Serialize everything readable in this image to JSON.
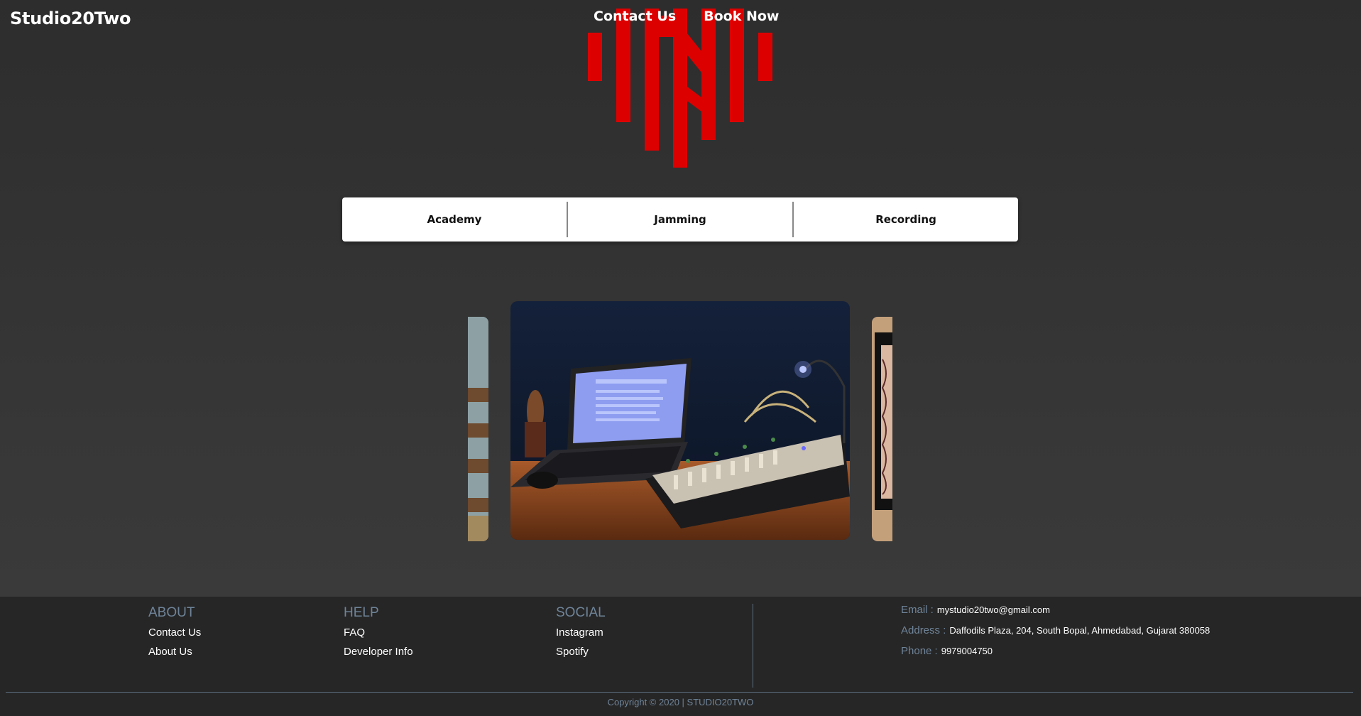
{
  "header": {
    "brand": "Studio20Two",
    "nav": {
      "contact": "Contact Us",
      "book": "Book Now"
    },
    "logo_color": "#dd0000"
  },
  "tabs": [
    {
      "label": "Academy"
    },
    {
      "label": "Jamming"
    },
    {
      "label": "Recording"
    }
  ],
  "carousel": {
    "slides": [
      "studio-room",
      "laptop-and-mixing-console",
      "framed-artwork"
    ]
  },
  "footer": {
    "about": {
      "title": "ABOUT",
      "links": [
        "Contact Us",
        "About Us"
      ]
    },
    "help": {
      "title": "HELP",
      "links": [
        "FAQ",
        "Developer Info"
      ]
    },
    "social": {
      "title": "SOCIAL",
      "links": [
        "Instagram",
        "Spotify"
      ]
    },
    "contact": {
      "email_label": "Email :",
      "email": "mystudio20two@gmail.com",
      "address_label": "Address :",
      "address": "Daffodils Plaza, 204, South Bopal, Ahmedabad, Gujarat 380058",
      "phone_label": "Phone :",
      "phone": "9979004750"
    },
    "copyright": "Copyright © 2020 | STUDIO20TWO"
  },
  "colors": {
    "accent": "#dd0000",
    "footer_heading": "#6f8499",
    "background": "#2f2f2f"
  }
}
